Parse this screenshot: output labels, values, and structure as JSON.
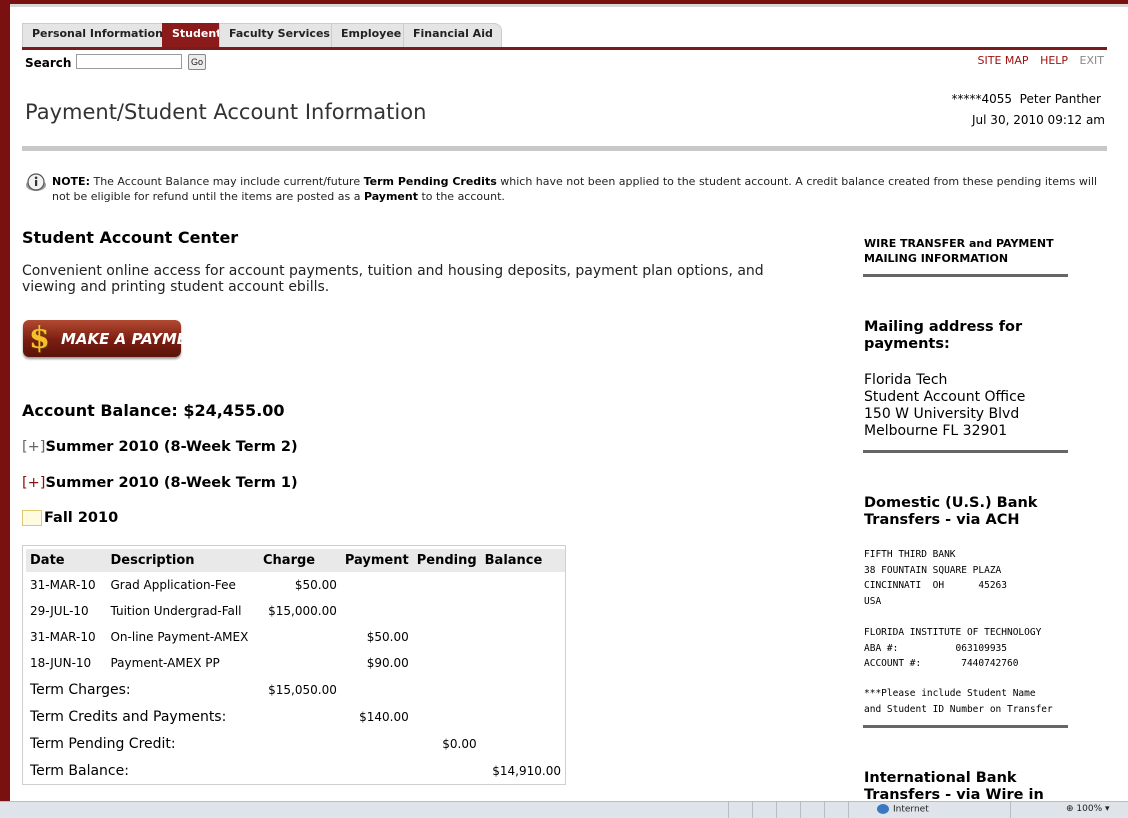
{
  "tabs": [
    {
      "label": "Personal Information",
      "active": false
    },
    {
      "label": "Student",
      "active": true
    },
    {
      "label": "Faculty Services",
      "active": false
    },
    {
      "label": "Employee",
      "active": false
    },
    {
      "label": "Financial Aid",
      "active": false
    }
  ],
  "search": {
    "label": "Search",
    "value": "",
    "button": "Go"
  },
  "toplinks": {
    "sitemap": "SITE MAP",
    "help": "HELP",
    "exit": "EXIT"
  },
  "header": {
    "title": "Payment/Student Account Information",
    "user": "*****4055  Peter Panther",
    "datetime": "Jul 30, 2010 09:12 am"
  },
  "note": {
    "label": "NOTE:",
    "text_1": " The Account Balance may include current/future ",
    "bold_1": "Term Pending Credits",
    "text_2": " which have not been applied to the student account. A credit balance created from these pending items will not be eligible for refund until the items are posted as a ",
    "bold_2": "Payment",
    "text_3": " to the account."
  },
  "main": {
    "section_title": "Student Account Center",
    "description": "Convenient online access for account payments, tuition and housing deposits, payment plan options, and viewing and printing student account ebills.",
    "make_payment": "MAKE A PAYMENT",
    "make_payment_symbol": "$",
    "account_balance": "Account Balance: $24,455.00",
    "terms": [
      {
        "toggle": "[+]",
        "name": "Summer 2010 (8-Week Term 2)"
      },
      {
        "toggle": "[+]",
        "name": "Summer 2010 (8-Week Term 1)"
      },
      {
        "toggle": "",
        "name": "Fall 2010"
      }
    ],
    "table": {
      "headers": [
        "Date",
        "Description",
        "Charge",
        "Payment",
        "Pending",
        "Balance"
      ],
      "rows": [
        {
          "date": "31-MAR-10",
          "desc": "Grad Application-Fee",
          "charge": "$50.00",
          "payment": "",
          "pending": "",
          "balance": ""
        },
        {
          "date": "29-JUL-10",
          "desc": "Tuition Undergrad-Fall",
          "charge": "$15,000.00",
          "payment": "",
          "pending": "",
          "balance": ""
        },
        {
          "date": "31-MAR-10",
          "desc": "On-line Payment-AMEX",
          "charge": "",
          "payment": "$50.00",
          "pending": "",
          "balance": ""
        },
        {
          "date": "18-JUN-10",
          "desc": "Payment-AMEX PP",
          "charge": "",
          "payment": "$90.00",
          "pending": "",
          "balance": ""
        }
      ],
      "summary": {
        "term_charges_label": "Term Charges:",
        "term_charges": "$15,050.00",
        "credits_label": "Term Credits and Payments:",
        "credits": "$140.00",
        "pending_label": "Term Pending Credit:",
        "pending": "$0.00",
        "balance_label": "Term Balance:",
        "balance": "$14,910.00"
      }
    }
  },
  "sidebar": {
    "wire_title": "WIRE TRANSFER and PAYMENT MAILING INFORMATION",
    "mail_title": "Mailing address for payments:",
    "mail_lines": [
      "Florida Tech",
      "Student Account Office",
      "150 W University Blvd",
      "Melbourne FL 32901"
    ],
    "domestic_title": "Domestic (U.S.) Bank Transfers - via ACH",
    "bank_block": "FIFTH THIRD BANK\n38 FOUNTAIN SQUARE PLAZA\nCINCINNATI  OH      45263\nUSA",
    "account_block": "FLORIDA INSTITUTE OF TECHNOLOGY\nABA #:          063109935\nACCOUNT #:       7440742760",
    "notice_block": "***Please include Student Name\nand Student ID Number on Transfer",
    "international_title": "International Bank Transfers - via Wire in"
  },
  "statusbar": {
    "zone": "Internet",
    "zoom": "100%"
  }
}
